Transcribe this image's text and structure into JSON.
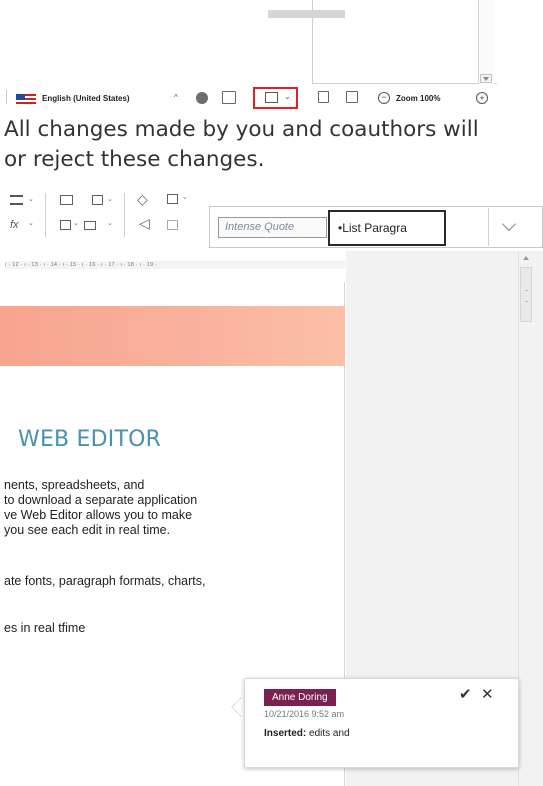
{
  "status_bar": {
    "language": "English (United States)",
    "zoom_label": "Zoom 100%"
  },
  "caption": {
    "line1": "All changes made by you and coauthors will",
    "line2": "or reject these changes."
  },
  "styles": {
    "intense_quote": "Intense Quote",
    "list_paragraph": "•List Paragra"
  },
  "ruler": {
    "ticks": "ı · 12 · ı · 13 · ı · 14 · ı · 15 · ı · 16 · ı · 17 · ı · 18 · ı · 19 ·"
  },
  "document": {
    "title": "WEB EDITOR",
    "para1": [
      "nents, spreadsheets, and",
      "to download a separate application",
      "ve Web Editor allows you to make",
      " you see each edit in real time."
    ],
    "para2": "ate fonts, paragraph formats, charts,",
    "para3": "es in real tfime"
  },
  "comment": {
    "author": "Anne Doring",
    "timestamp": "10/21/2016 9:52 am",
    "change_type": "Inserted:",
    "change_text": "edits and",
    "accept_symbol": "✔",
    "reject_symbol": "✕"
  },
  "colors": {
    "author_badge": "#7b2150",
    "title": "#4a90b0",
    "highlight_box": "#e02222",
    "banner": "#f8a48e"
  }
}
